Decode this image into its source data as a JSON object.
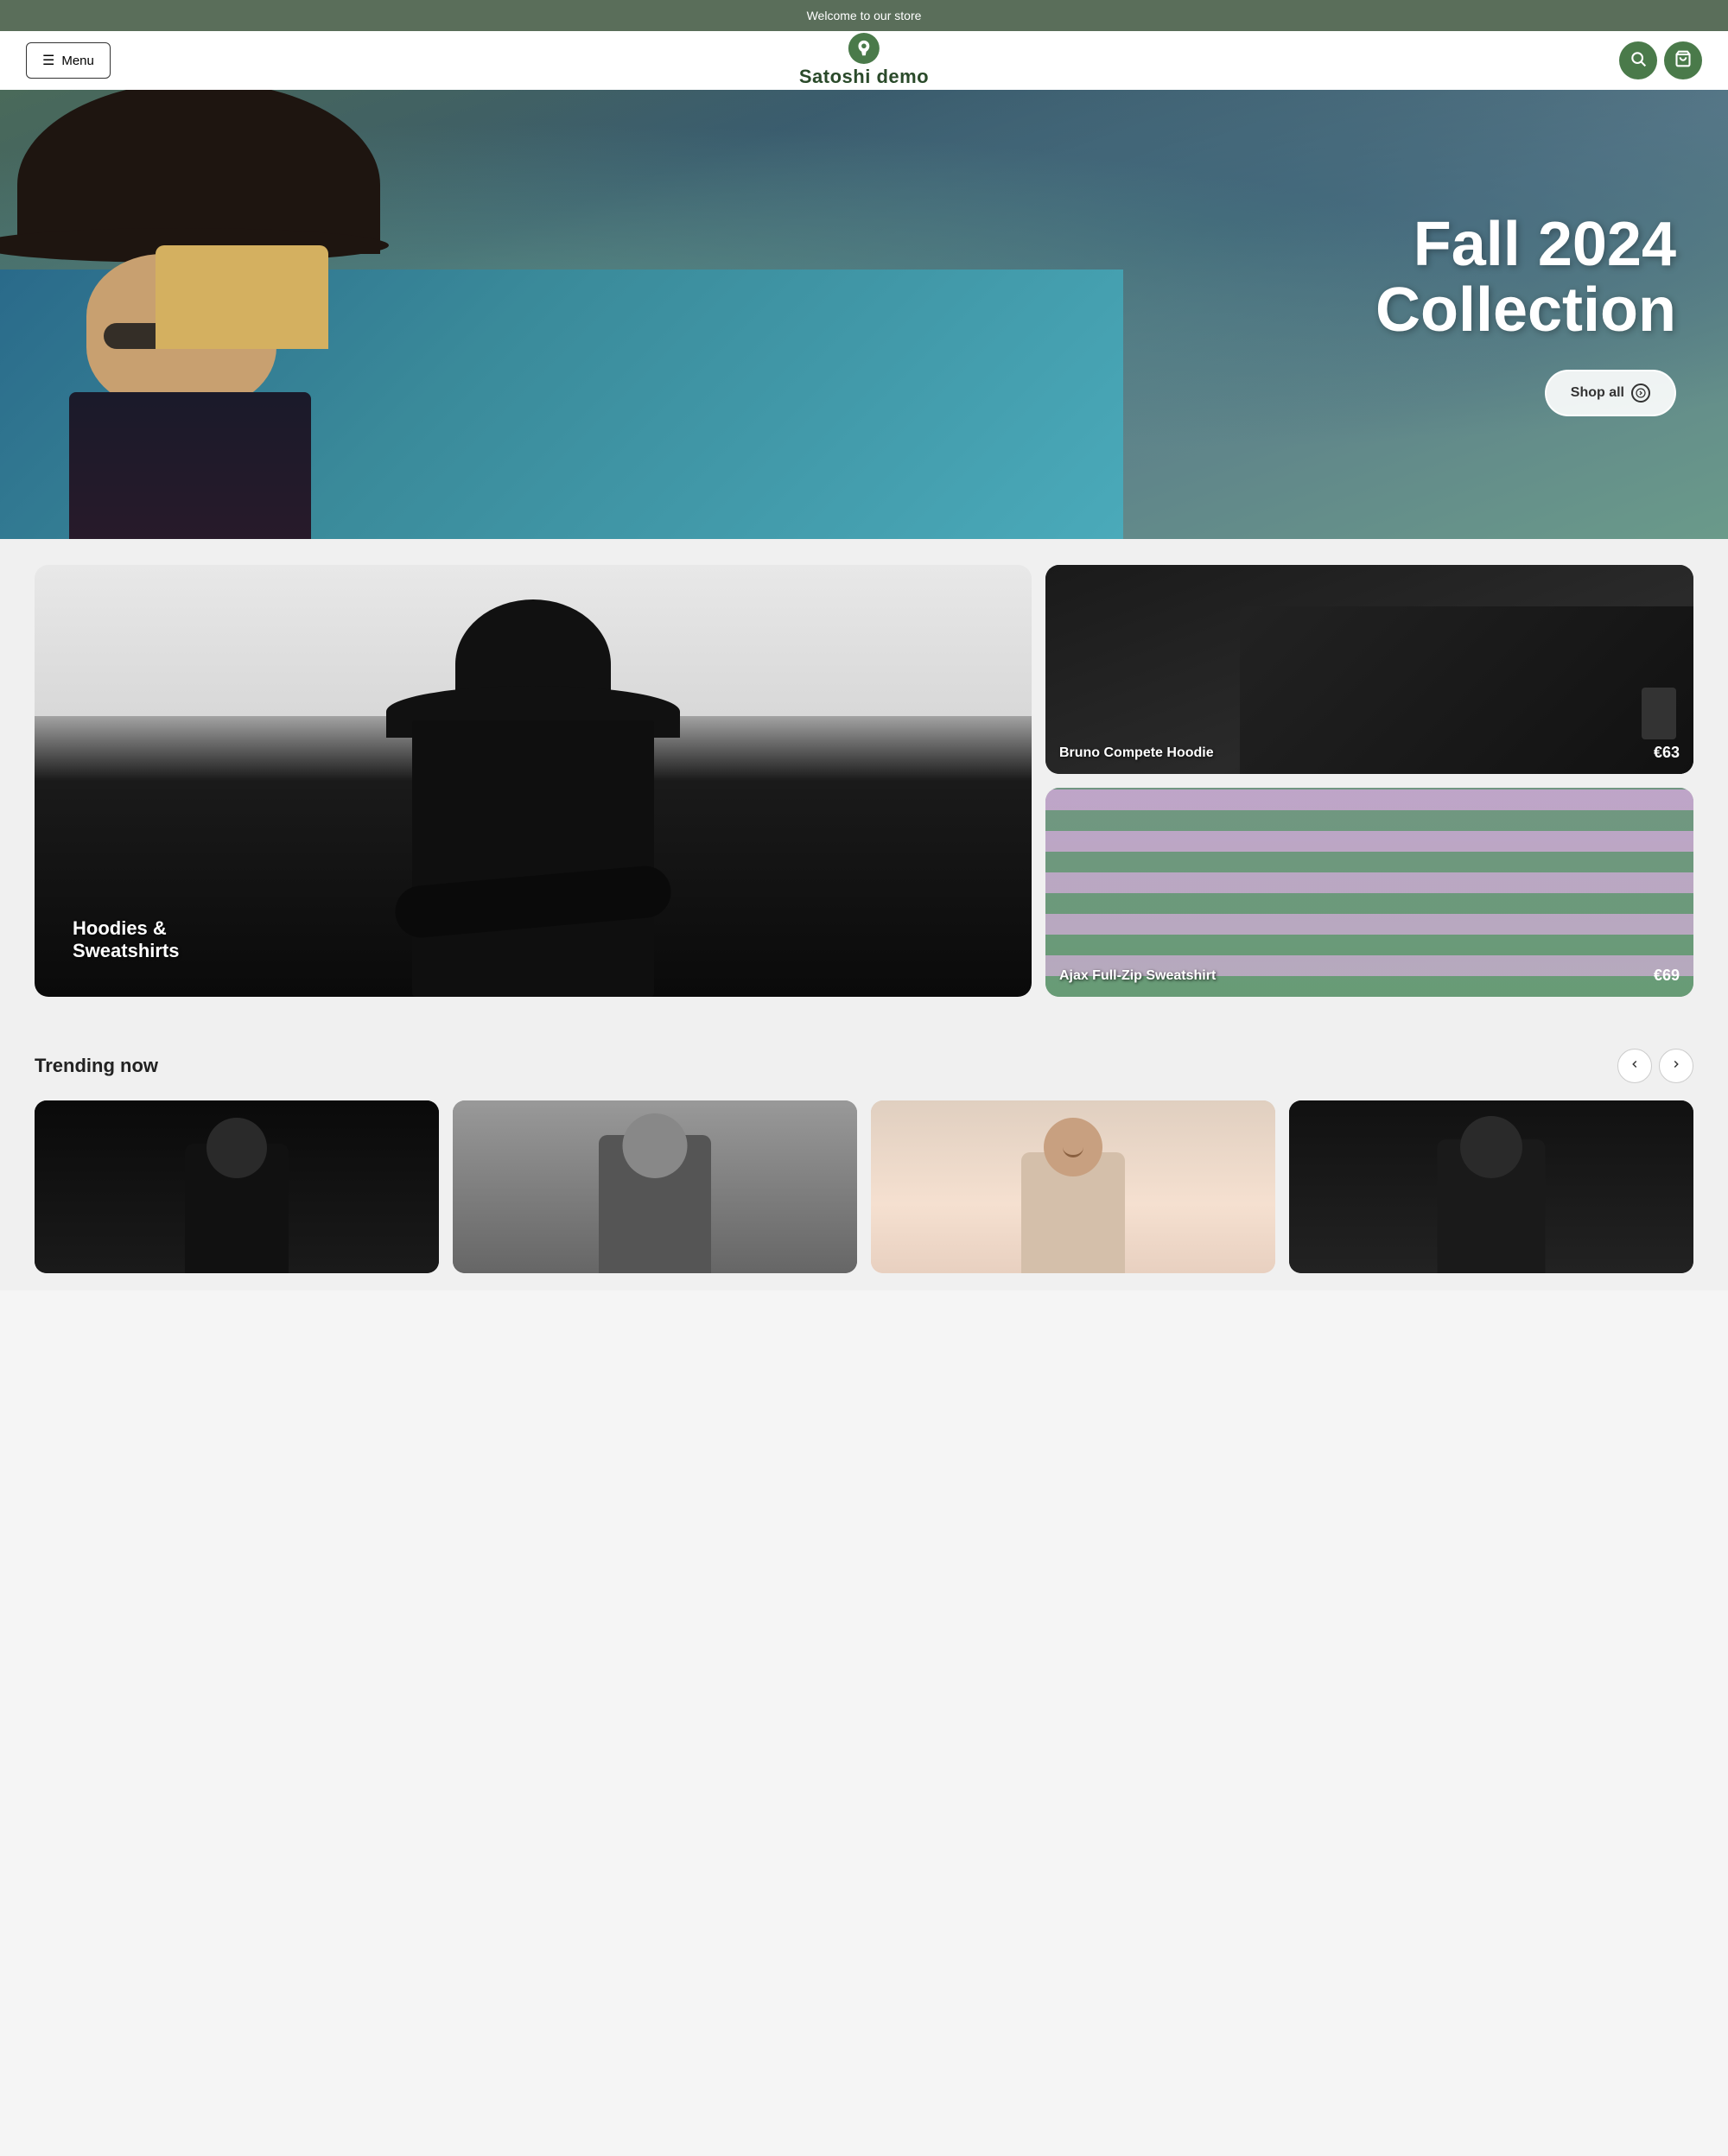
{
  "announcement": {
    "text": "Welcome to our store"
  },
  "header": {
    "menu_label": "Menu",
    "store_name": "Satoshi demo"
  },
  "hero": {
    "title_line1": "Fall 2024",
    "title_line2": "Collection",
    "shop_all_label": "Shop all"
  },
  "categories": {
    "large_card": {
      "label": "Hoodies & Sweatshirts"
    },
    "products": [
      {
        "name": "Bruno Compete Hoodie",
        "price": "€63"
      },
      {
        "name": "Ajax Full-Zip Sweatshirt",
        "price": "€69"
      }
    ]
  },
  "trending": {
    "title": "Trending now",
    "prev_label": "<",
    "next_label": ">"
  },
  "icons": {
    "hamburger": "☰",
    "search": "🔍",
    "cart": "🛍",
    "arrow_right": "→"
  }
}
